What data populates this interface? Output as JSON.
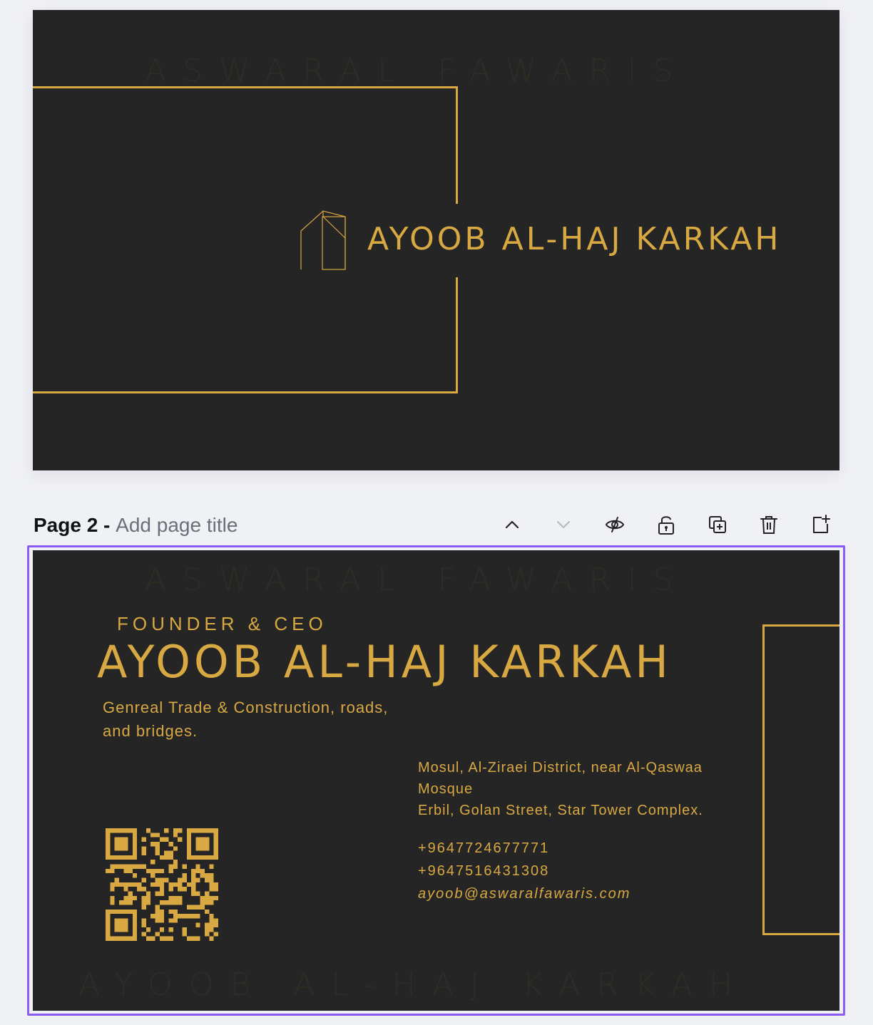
{
  "page1": {
    "watermark": "ASWARAL FAWARIS",
    "name": "AYOOB AL-HAJ KARKAH"
  },
  "page2_header": {
    "label": "Page 2 - ",
    "title_placeholder": "Add page title",
    "tools": [
      "chevron-up-icon",
      "chevron-down-icon",
      "hide-icon",
      "lock-icon",
      "duplicate-icon",
      "trash-icon",
      "add-page-icon"
    ]
  },
  "page2": {
    "watermark_top": "ASWARAL FAWARIS",
    "watermark_bottom": "AYOOB AL-HAJ KARKAH",
    "role": "FOUNDER & CEO",
    "name": "AYOOB AL-HAJ KARKAH",
    "tagline": "Genreal Trade & Construction, roads, and bridges.",
    "address_line1": "Mosul, Al-Ziraei District, near Al-Qaswaa Mosque",
    "address_line2": "Erbil, Golan Street, Star Tower Complex.",
    "phone1": "+9647724677771",
    "phone2": "+9647516431308",
    "email": "ayoob@aswaralfawaris.com"
  },
  "colors": {
    "card_bg": "#252525",
    "gold": "#d8a842",
    "selection": "#8b5cf6"
  }
}
